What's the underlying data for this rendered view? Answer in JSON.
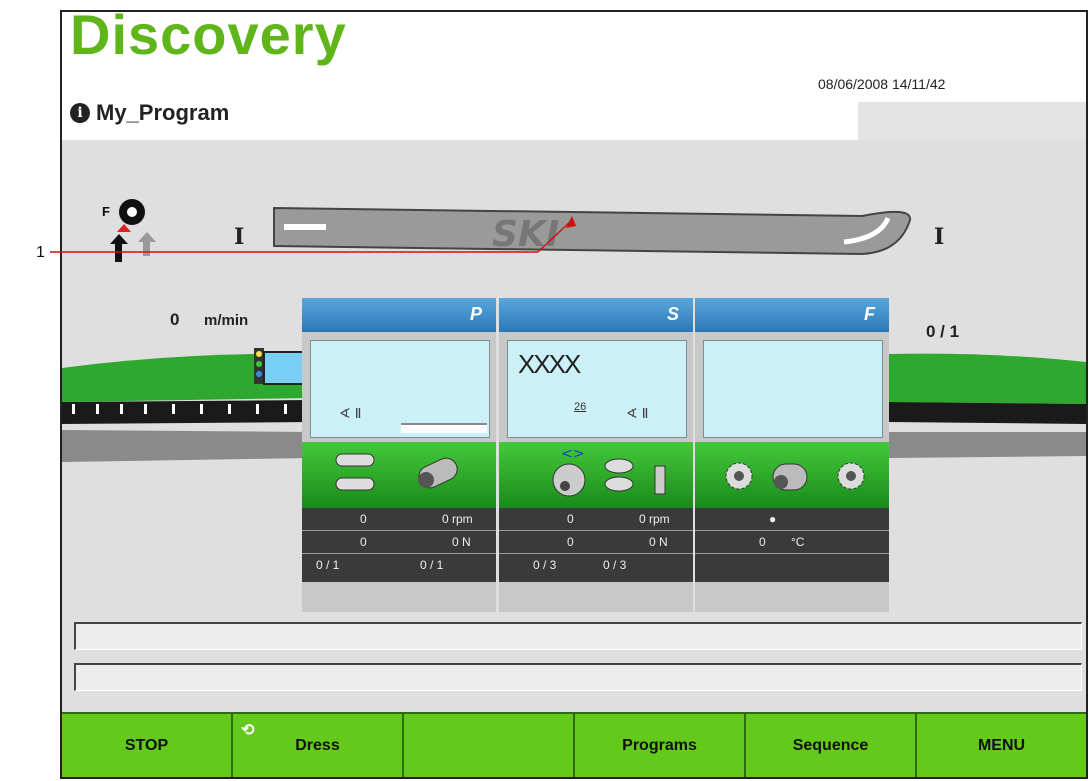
{
  "header": {
    "app_title": "Discovery",
    "program_name": "My_Program",
    "datetime": "08/06/2008 14/11/42",
    "info_icon": "i"
  },
  "ski": {
    "label": "SKI",
    "left_marker": "I",
    "right_marker": "I",
    "feed_label": "F"
  },
  "speed": {
    "value": "0",
    "unit": "m/min",
    "count": "0 / 1"
  },
  "units": [
    {
      "letter": "P",
      "display_text": "",
      "display_sub": "",
      "rows": [
        [
          "0",
          "0 rpm"
        ],
        [
          "0",
          "0 N"
        ],
        [
          "0 / 1",
          "0 / 1"
        ]
      ]
    },
    {
      "letter": "S",
      "display_text": "XXXX",
      "display_sub": "26",
      "rows": [
        [
          "0",
          "0 rpm"
        ],
        [
          "0",
          "0 N"
        ],
        [
          "0 / 3",
          "0 / 3"
        ]
      ]
    },
    {
      "letter": "F",
      "display_text": "",
      "display_sub": "",
      "rows": [
        [
          "●",
          ""
        ],
        [
          "0",
          "°C"
        ],
        [
          "",
          ""
        ]
      ]
    }
  ],
  "callout": {
    "number": "1"
  },
  "buttons": {
    "stop": "STOP",
    "dress": "Dress",
    "empty": "",
    "programs": "Programs",
    "sequence": "Sequence",
    "menu": "MENU"
  },
  "colors": {
    "brand_green": "#5fb51a",
    "button_green": "#63c91a",
    "unit_blue": "#2a78b8",
    "display_cyan": "#ccf0f7"
  }
}
